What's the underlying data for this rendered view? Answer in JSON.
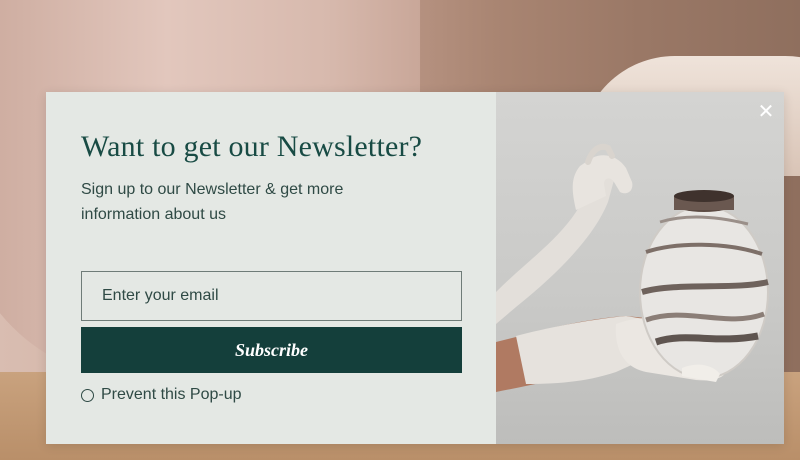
{
  "popup": {
    "title": "Want to get our Newsletter?",
    "subtitle": "Sign up to our Newsletter & get more information about us",
    "email_placeholder": "Enter your email",
    "email_value": "",
    "subscribe_label": "Subscribe",
    "prevent_label": "Prevent this Pop-up",
    "prevent_checked": false,
    "close_icon": "close-icon"
  },
  "colors": {
    "accent": "#143f3b",
    "title": "#184b44",
    "panel_bg": "#e4e8e4"
  }
}
